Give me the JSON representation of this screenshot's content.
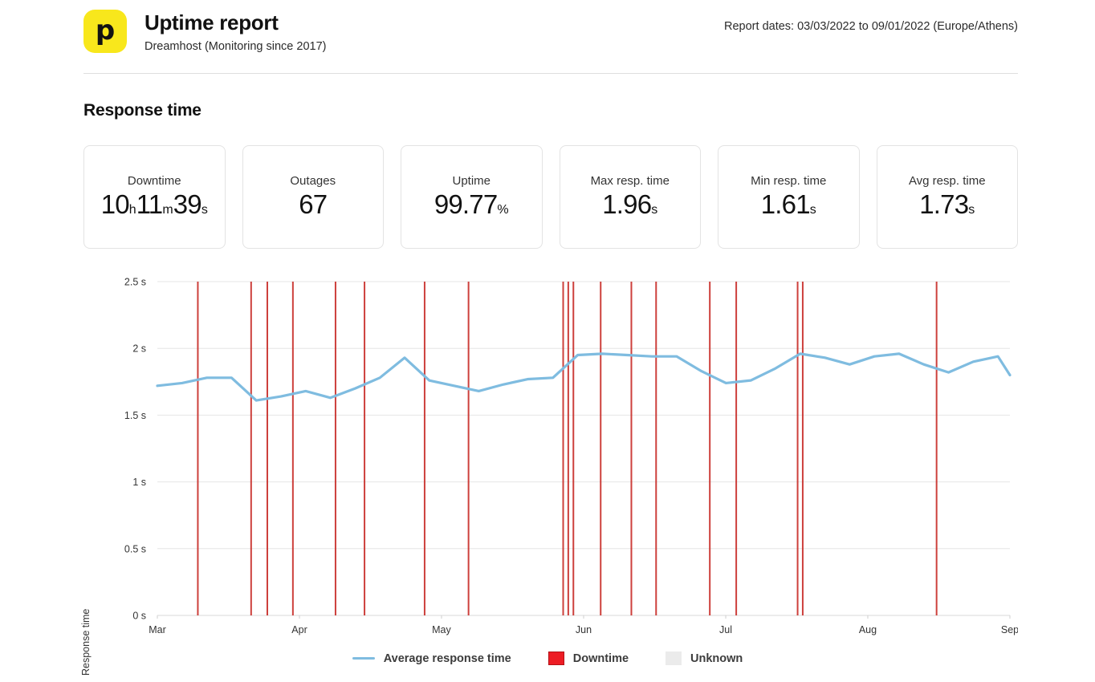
{
  "header": {
    "logo_icon": "pingdom-p-logo-icon",
    "logo_glyph": "p",
    "logo_color": "#F8E71C",
    "title": "Uptime report",
    "subtitle": "Dreamhost (Monitoring since 2017)",
    "report_dates": "Report dates: 03/03/2022 to 09/01/2022 (Europe/Athens)"
  },
  "section": {
    "title": "Response time"
  },
  "cards": [
    {
      "label": "Downtime",
      "value": "10",
      "unit": "h",
      "value2": "11",
      "unit2": "m",
      "value3": "39",
      "unit3": "s"
    },
    {
      "label": "Outages",
      "value": "67",
      "unit": ""
    },
    {
      "label": "Uptime",
      "value": "99.77",
      "unit": "%"
    },
    {
      "label": "Max resp. time",
      "value": "1.96",
      "unit": "s"
    },
    {
      "label": "Min resp. time",
      "value": "1.61",
      "unit": "s"
    },
    {
      "label": "Avg resp. time",
      "value": "1.73",
      "unit": "s"
    }
  ],
  "legend": [
    {
      "name": "average-response-time",
      "label": "Average response time",
      "type": "line",
      "color": "#7FBCE0"
    },
    {
      "name": "downtime",
      "label": "Downtime",
      "type": "swatch",
      "color": "#ED1C24"
    },
    {
      "name": "unknown",
      "label": "Unknown",
      "type": "swatch",
      "color": "#EBEBEB"
    }
  ],
  "chart_data": {
    "type": "line",
    "title": "Response time",
    "xlabel": "",
    "ylabel": "Response time",
    "ylim": [
      0,
      2.5
    ],
    "yticks": [
      0,
      0.5,
      1,
      1.5,
      2,
      2.5
    ],
    "ytick_labels": [
      "0 s",
      "0.5 s",
      "1 s",
      "1.5 s",
      "2 s",
      "2.5 s"
    ],
    "grid": true,
    "legend_position": "bottom",
    "xtick_labels": [
      "Mar",
      "Apr",
      "May",
      "Jun",
      "Jul",
      "Aug",
      "Sep"
    ],
    "xtick_positions": [
      0.0,
      0.1667,
      0.3333,
      0.5,
      0.6667,
      0.8333,
      1.0
    ],
    "x_range_start": "03/03/2022",
    "x_range_end": "09/01/2022",
    "series": [
      {
        "name": "Average response time",
        "color": "#7FBCE0",
        "x": [
          0.0,
          0.029,
          0.058,
          0.087,
          0.116,
          0.145,
          0.174,
          0.203,
          0.232,
          0.261,
          0.29,
          0.319,
          0.348,
          0.377,
          0.406,
          0.435,
          0.464,
          0.493,
          0.522,
          0.551,
          0.58,
          0.609,
          0.638,
          0.667,
          0.696,
          0.725,
          0.754,
          0.783,
          0.812,
          0.841,
          0.87,
          0.899,
          0.928,
          0.957,
          0.986,
          1.0
        ],
        "values": [
          1.72,
          1.74,
          1.78,
          1.78,
          1.61,
          1.64,
          1.68,
          1.63,
          1.7,
          1.78,
          1.93,
          1.76,
          1.72,
          1.68,
          1.73,
          1.77,
          1.78,
          1.95,
          1.96,
          1.95,
          1.94,
          1.94,
          1.83,
          1.74,
          1.76,
          1.85,
          1.96,
          1.93,
          1.88,
          1.94,
          1.96,
          1.88,
          1.82,
          1.9,
          1.94,
          1.8
        ]
      }
    ],
    "downtime_markers": {
      "name": "Downtime",
      "color": "#C9302C",
      "x": [
        0.0475,
        0.11,
        0.129,
        0.159,
        0.209,
        0.243,
        0.3135,
        0.365,
        0.476,
        0.482,
        0.488,
        0.52,
        0.556,
        0.585,
        0.648,
        0.679,
        0.751,
        0.757,
        0.914
      ]
    }
  }
}
